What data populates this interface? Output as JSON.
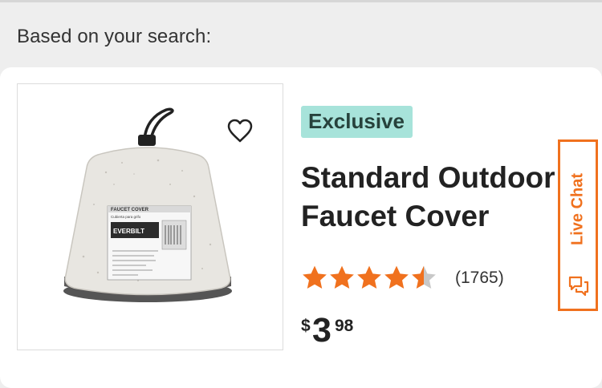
{
  "section": {
    "label": "Based on your search:"
  },
  "product": {
    "badge": "Exclusive",
    "title_line1": "Standard Outdoor",
    "title_line2": "Faucet Cover",
    "rating_value": 4.5,
    "rating_max": 5,
    "rating_count": "(1765)",
    "price": {
      "currency": "$",
      "dollars": "3",
      "cents": "98"
    },
    "image": {
      "icon": "faucet-cover-product-image",
      "package_text_1": "FAUCET COVER",
      "package_text_2": "Cubierta para grifo",
      "package_brand": "EVERBILT"
    },
    "favorite_icon": "heart-icon"
  },
  "live_chat": {
    "label": "Live Chat",
    "icon": "chat-bubbles-icon"
  },
  "colors": {
    "accent_orange": "#f0711e",
    "badge_bg": "#a7e3da",
    "badge_text": "#27423c",
    "star_filled": "#f0711e",
    "star_empty": "#c8c8c8"
  }
}
